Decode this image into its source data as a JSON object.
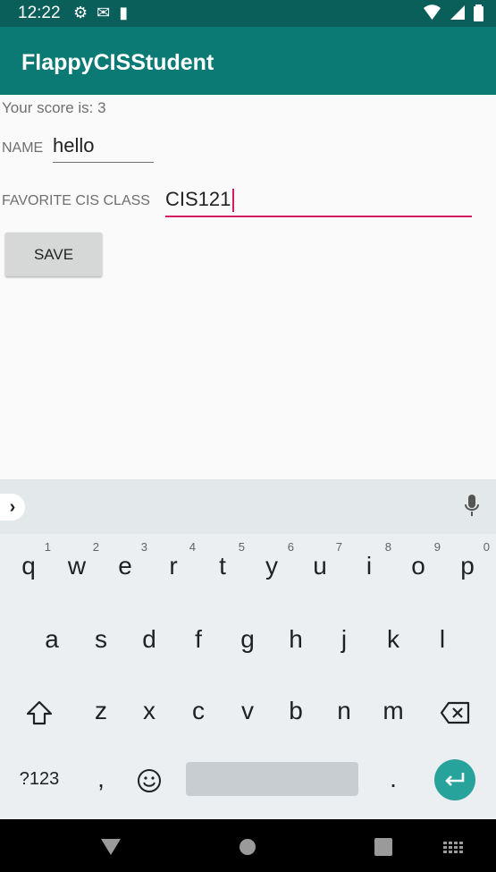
{
  "status_bar": {
    "time": "12:22",
    "left_icons": [
      "settings-icon",
      "gmail-icon",
      "sd-card-icon"
    ],
    "right_icons": [
      "wifi-icon",
      "cell-signal-icon",
      "battery-icon"
    ]
  },
  "app_bar": {
    "title": "FlappyCISStudent",
    "color": "#0c7a74"
  },
  "form": {
    "score_text": "Your score is: 3",
    "name_label": "NAME",
    "name_value": "hello",
    "favorite_label": "FAVORITE CIS CLASS",
    "favorite_value": "CIS121",
    "save_label": "SAVE",
    "focus_color": "#d81b60"
  },
  "keyboard": {
    "row1": [
      {
        "key": "q",
        "hint": "1"
      },
      {
        "key": "w",
        "hint": "2"
      },
      {
        "key": "e",
        "hint": "3"
      },
      {
        "key": "r",
        "hint": "4"
      },
      {
        "key": "t",
        "hint": "5"
      },
      {
        "key": "y",
        "hint": "6"
      },
      {
        "key": "u",
        "hint": "7"
      },
      {
        "key": "i",
        "hint": "8"
      },
      {
        "key": "o",
        "hint": "9"
      },
      {
        "key": "p",
        "hint": "0"
      }
    ],
    "row2": [
      "a",
      "s",
      "d",
      "f",
      "g",
      "h",
      "j",
      "k",
      "l"
    ],
    "row3": [
      "z",
      "x",
      "c",
      "v",
      "b",
      "n",
      "m"
    ],
    "symbols_label": "?123",
    "comma": ",",
    "period": ".",
    "icons": [
      "chevron-right-icon",
      "microphone-icon",
      "shift-icon",
      "backspace-icon",
      "emoji-icon",
      "enter-icon"
    ],
    "enter_color": "#28a39c"
  },
  "nav_bar": {
    "icons": [
      "back-icon",
      "home-icon",
      "recents-icon",
      "keyboard-switch-icon"
    ]
  }
}
